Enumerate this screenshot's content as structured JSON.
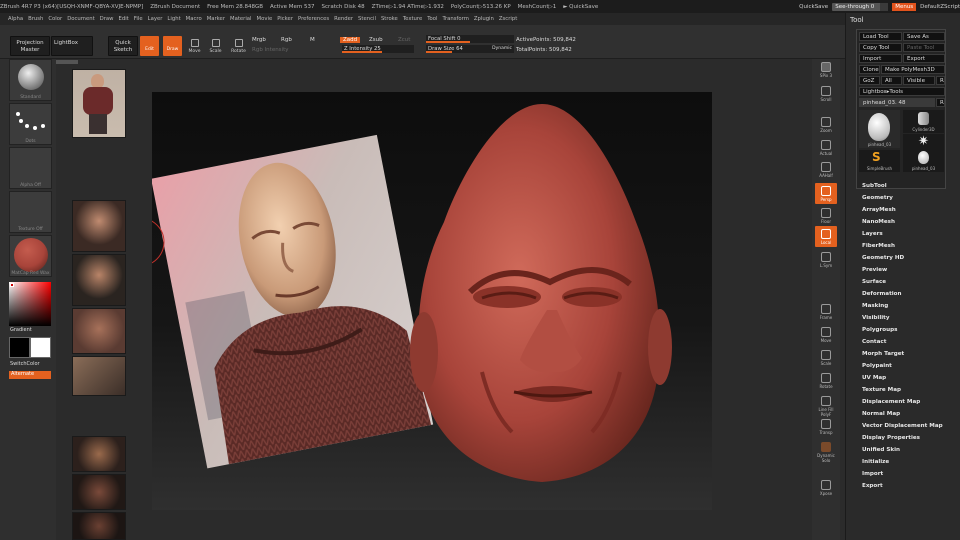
{
  "titlebar": {
    "items": [
      "ZBrush 4R7 P3 (x64)[USQH-XNMF-QBYA-XVJE-NPMP]",
      "ZBrush Document",
      "Free Mem 28.848GB",
      "Active Mem 537",
      "Scratch Disk 48",
      "ZTime▷1.94 ATime▷1.932",
      "PolyCount▷513.26 KP",
      "MeshCount▷1",
      "► QuickSave"
    ],
    "quicksave": "QuickSave",
    "seethrough": "See-through 0",
    "menus": "Menus",
    "script": "DefaultZScript"
  },
  "menubar": [
    "Alpha",
    "Brush",
    "Color",
    "Document",
    "Draw",
    "Edit",
    "File",
    "Layer",
    "Light",
    "Macro",
    "Marker",
    "Material",
    "Movie",
    "Picker",
    "Preferences",
    "Render",
    "Stencil",
    "Stroke",
    "Texture",
    "Tool",
    "Transform",
    "Zplugin",
    "Zscript"
  ],
  "toolbar": {
    "projection_master": "Projection Master",
    "lightbox": "LightBox",
    "quick_sketch": "Quick Sketch",
    "edit": "Edit",
    "draw": "Draw",
    "move": "Move",
    "scale": "Scale",
    "rotate": "Rotate",
    "mrgb": "Mrgb",
    "rgb": "Rgb",
    "m": "M",
    "rgb_intensity": "Rgb Intensity",
    "zadd": "Zadd",
    "zsub": "Zsub",
    "zcut": "Zcut",
    "z_intensity": "Z Intensity 25",
    "focal_shift": "Focal Shift 0",
    "draw_size": "Draw Size 64",
    "dynamic": "Dynamic",
    "active_points": "ActivePoints: 509,842",
    "total_points": "TotalPoints: 509,842"
  },
  "leftshelf": {
    "slots": [
      "Standard",
      "Dots",
      "Alpha Off",
      "Texture Off",
      "MatCap Red Wax"
    ],
    "gradient": "Gradient",
    "switchcolor": "SwitchColor",
    "alternate": "Alternate"
  },
  "rightshelf": [
    "SPix 3",
    "Scroll",
    "Zoom",
    "Actual",
    "AAHalf",
    "Persp",
    "Floor",
    "Local",
    "L.Sym",
    "Frame",
    "Move",
    "Scale",
    "Rotate",
    "Line Fill PolyF",
    "Transp",
    "Dynamic Solo",
    "Xpose"
  ],
  "toolpanel": {
    "title": "Tool",
    "load": "Load Tool",
    "save": "Save As",
    "copy": "Copy Tool",
    "paste": "Paste Tool",
    "import": "Import",
    "export": "Export",
    "clone": "Clone",
    "make_polymesh": "Make PolyMesh3D",
    "goz": "GoZ",
    "all": "All",
    "visible": "Visible",
    "r": "R",
    "lightbox_tools": "Lightbox▸Tools",
    "current": "pinhead_03. 48",
    "thumbs": [
      "pinhead_03",
      "Cylinder3D",
      "PolyMesh3D",
      "SimpleBrush",
      "pinhead_03"
    ],
    "submenus": [
      "SubTool",
      "Geometry",
      "ArrayMesh",
      "NanoMesh",
      "Layers",
      "FiberMesh",
      "Geometry HD",
      "Preview",
      "Surface",
      "Deformation",
      "Masking",
      "Visibility",
      "Polygroups",
      "Contact",
      "Morph Target",
      "Polypaint",
      "UV Map",
      "Texture Map",
      "Displacement Map",
      "Normal Map",
      "Vector Displacement Map",
      "Display Properties",
      "Unified Skin",
      "Initialize",
      "Import",
      "Export"
    ]
  },
  "colors": {
    "accent": "#e4611f",
    "wax": "#a8443a"
  }
}
